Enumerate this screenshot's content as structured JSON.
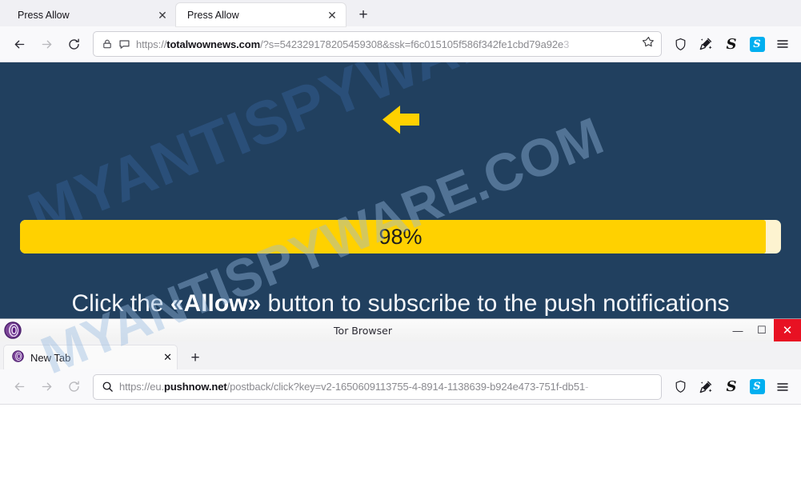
{
  "window1": {
    "tabs": [
      {
        "title": "Press Allow",
        "active": false
      },
      {
        "title": "Press Allow",
        "active": true
      }
    ],
    "new_tab_label": "+",
    "close_label": "✕",
    "nav": {
      "back": "back-arrow",
      "forward": "forward-arrow",
      "reload": "reload-icon"
    },
    "url": {
      "scheme": "https://",
      "domain": "totalwownews.com",
      "path": "/?s=542329178205459308&ssk=f6c015105f586f342fe1cbd79a92e",
      "tail": "3",
      "full": "https://totalwownews.com/?s=542329178205459308&ssk=f6c015105f586f342fe1cbd79a92e3"
    },
    "toolbar_icons": [
      "shield-icon",
      "new-identity-broom-icon",
      "strongbox-s-icon",
      "skype-s-icon",
      "hamburger-menu-icon"
    ],
    "skype_badge_letter": "S",
    "strongbox_letter": "S"
  },
  "page": {
    "background_color": "#21405f",
    "accent_color": "#ffd100",
    "watermark": "MYANTISPYWARE.COM",
    "arrow": "left-arrow-icon",
    "progress": {
      "percent": 98,
      "label": "98%",
      "fill_color": "#ffd100",
      "track_color": "#fdf3d0"
    },
    "cta": {
      "before": "Click the ",
      "highlight": "«Allow»",
      "after": " button to subscribe to the push notifications",
      "full": "Click the «Allow» button to subscribe to the push notifications"
    }
  },
  "window2": {
    "title": "Tor Browser",
    "app_icon": "tor-onion-icon",
    "controls": {
      "minimize": "—",
      "maximize": "☐",
      "close": "✕"
    },
    "tabs": [
      {
        "title": "New Tab",
        "icon": "tor-onion-icon",
        "active": true
      }
    ],
    "new_tab_label": "+",
    "close_label": "✕",
    "url": {
      "scheme": "https://eu.",
      "domain": "pushnow.net",
      "path": "/postback/click?key=v2-1650609113755-4-8914-1138639-b924e473-751f-db51",
      "tail": "-",
      "full": "https://eu.pushnow.net/postback/click?key=v2-1650609113755-4-8914-1138639-b924e473-751f-db51-"
    },
    "search_icon": "search-icon",
    "toolbar_icons": [
      "shield-icon",
      "new-identity-broom-icon",
      "strongbox-s-icon",
      "skype-s-icon",
      "hamburger-menu-icon"
    ],
    "watermark": "MYANTISPYWARE.COM"
  }
}
